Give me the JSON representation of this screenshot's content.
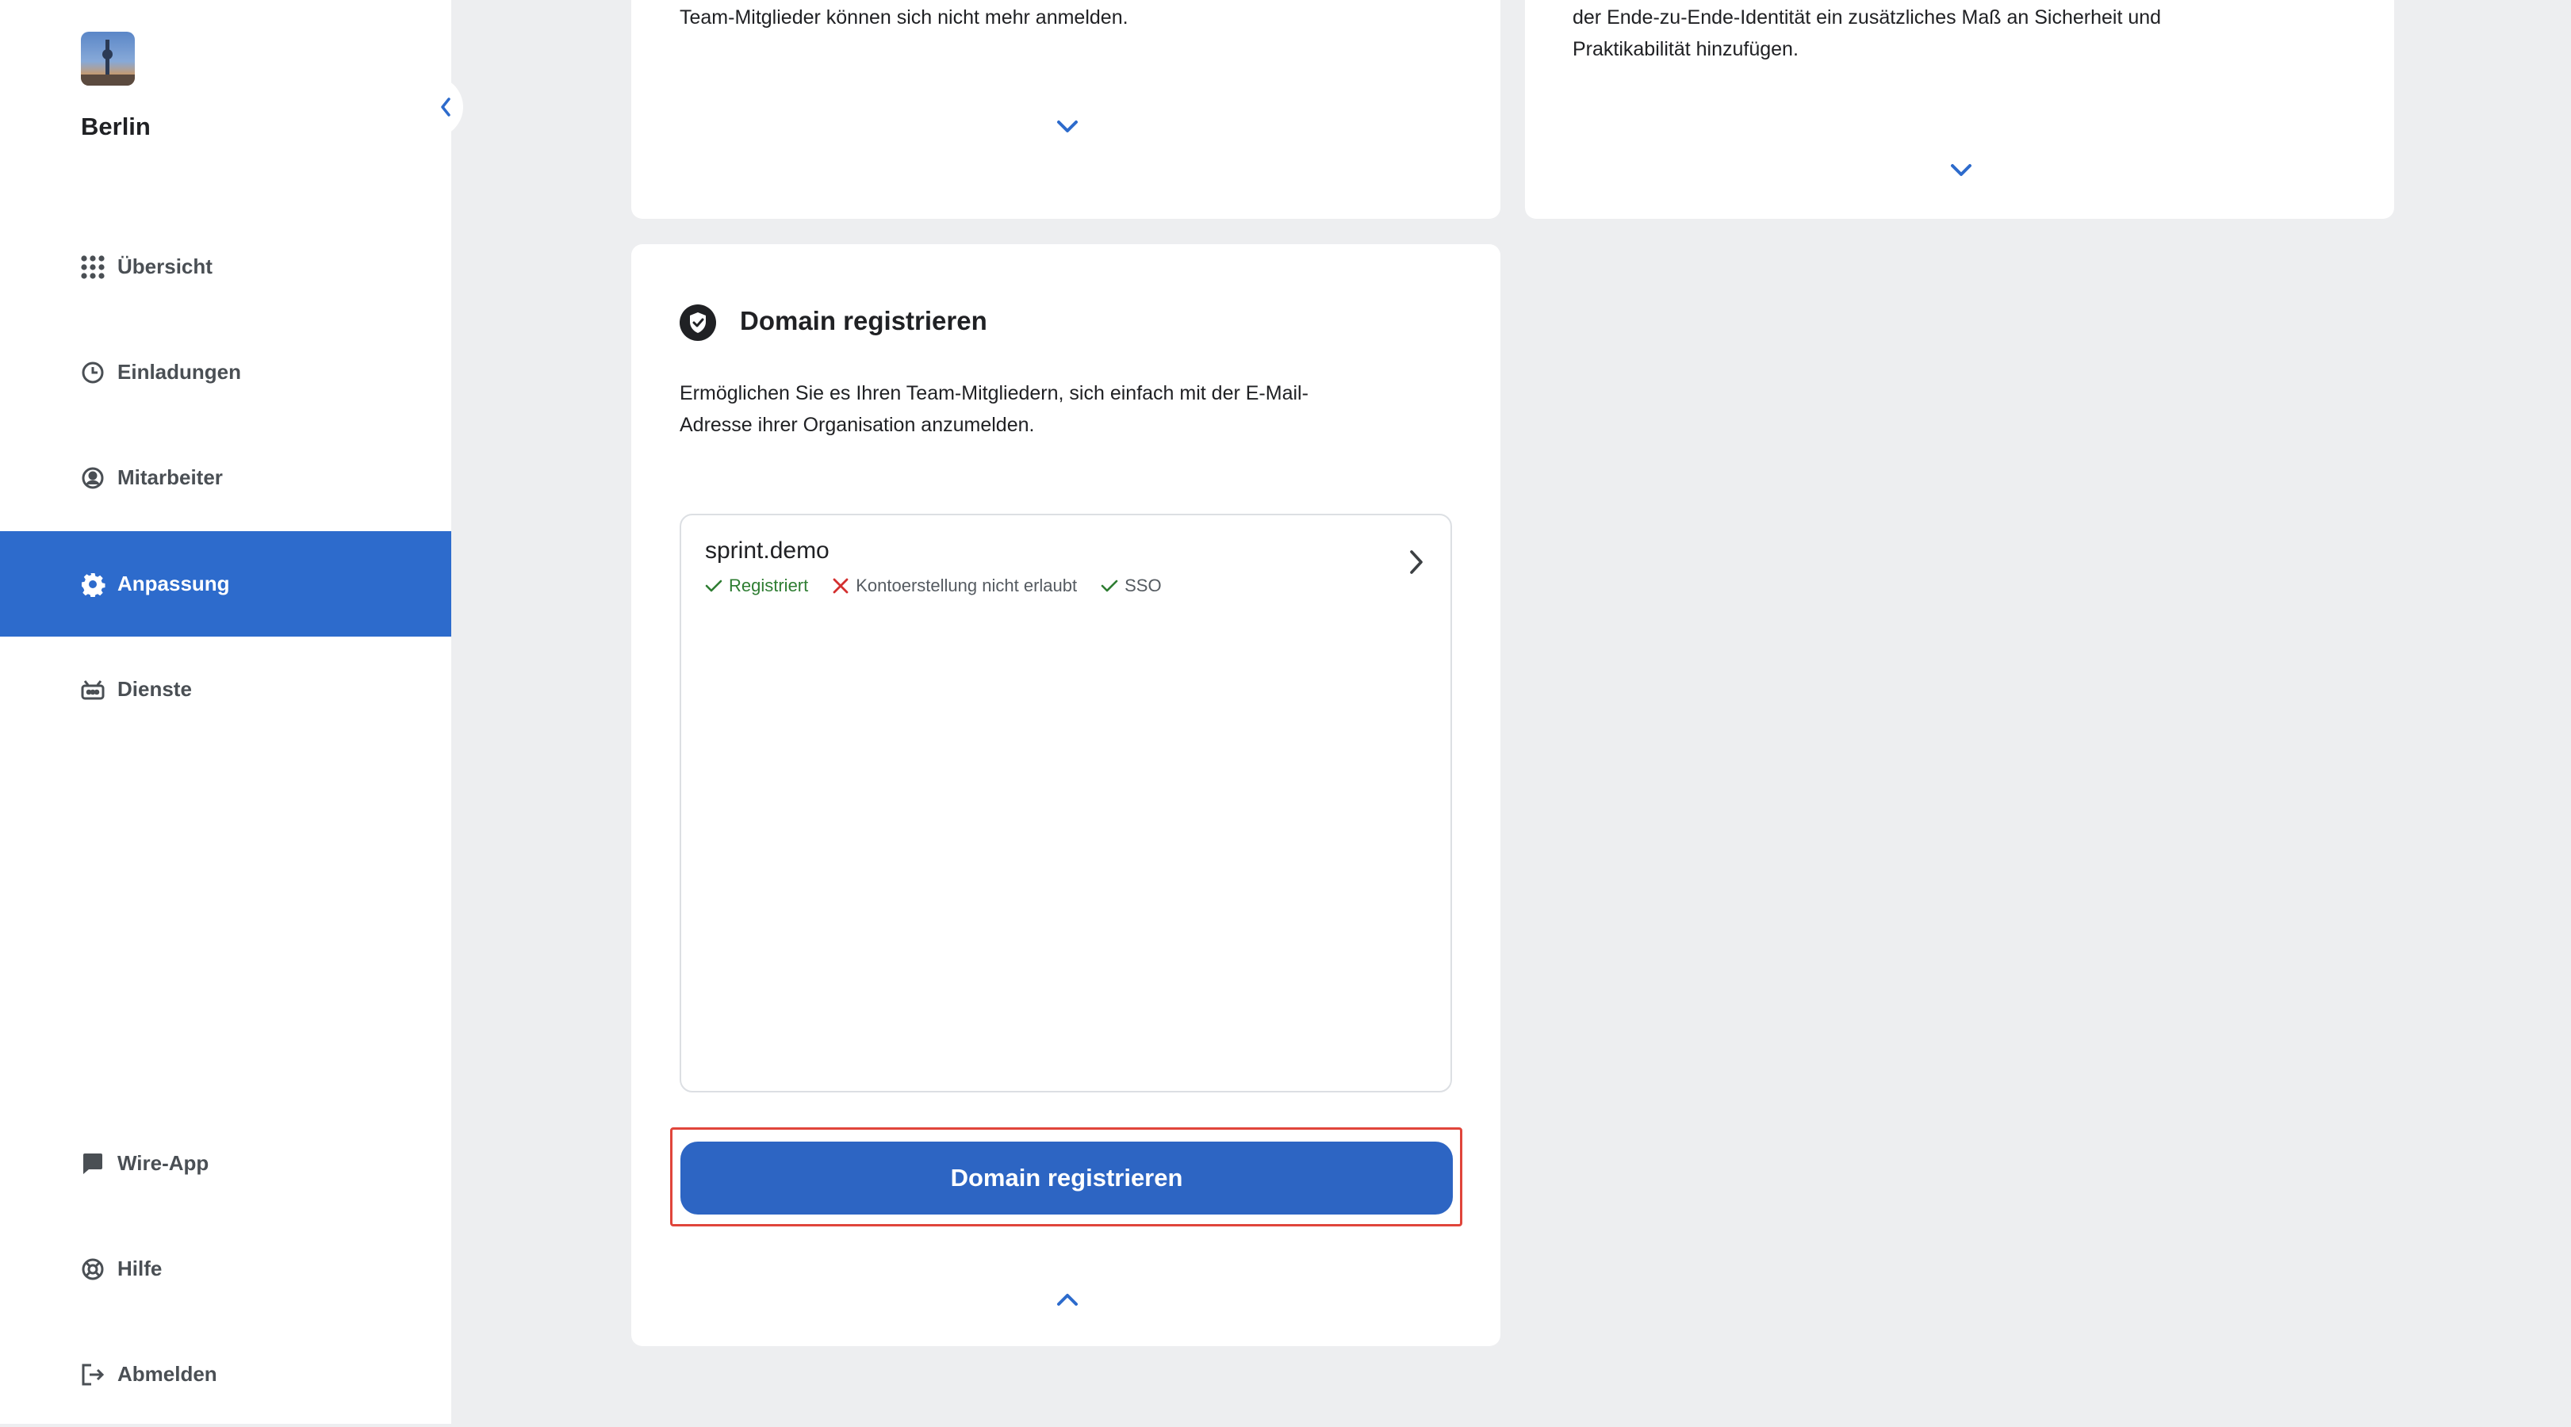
{
  "sidebar": {
    "team_name": "Berlin",
    "items": [
      {
        "label": "Übersicht",
        "icon": "grid-icon"
      },
      {
        "label": "Einladungen",
        "icon": "clock-icon"
      },
      {
        "label": "Mitarbeiter",
        "icon": "user-circle-icon"
      },
      {
        "label": "Anpassung",
        "icon": "gear-icon",
        "active": true
      },
      {
        "label": "Dienste",
        "icon": "robot-icon"
      },
      {
        "label": "Wire-App",
        "icon": "chat-bubble-icon"
      },
      {
        "label": "Hilfe",
        "icon": "lifebuoy-icon"
      },
      {
        "label": "Abmelden",
        "icon": "logout-icon"
      }
    ]
  },
  "cards": {
    "left_top": {
      "text": "Team-Mitglieder können sich nicht mehr anmelden."
    },
    "right_top": {
      "line1": "der Ende-zu-Ende-Identität ein zusätzliches Maß an Sicherheit und",
      "line2": "Praktikabilität hinzufügen."
    },
    "domain": {
      "title": "Domain registrieren",
      "description_line1": "Ermöglichen Sie es Ihren Team-Mitgliedern, sich einfach mit der E-Mail-",
      "description_line2": "Adresse ihrer Organisation anzumelden.",
      "entry": {
        "name": "sprint.demo",
        "status_registered": "Registriert",
        "status_account_creation": "Kontoerstellung nicht erlaubt",
        "status_sso": "SSO"
      },
      "button_label": "Domain registrieren"
    }
  },
  "colors": {
    "accent": "#2d6bcc",
    "success": "#2e7d32",
    "error": "#d32f2f",
    "highlight": "#e0453b"
  }
}
